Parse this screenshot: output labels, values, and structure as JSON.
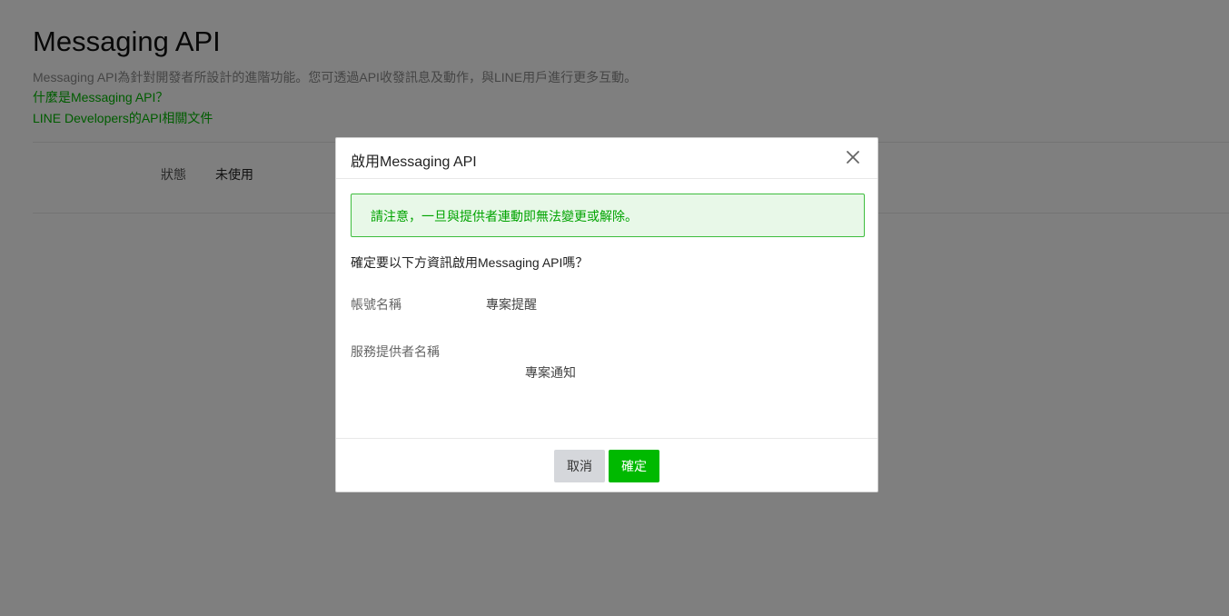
{
  "page": {
    "title": "Messaging API",
    "description": "Messaging API為針對開發者所設計的進階功能。您可透過API收發訊息及動作，與LINE用戶進行更多互動。",
    "links": [
      "什麼是Messaging API？",
      "LINE Developers的API相關文件"
    ],
    "status_label": "狀態",
    "status_value": "未使用"
  },
  "modal": {
    "title": "啟用Messaging API",
    "close_icon": "close-icon",
    "alert": "請注意，一旦與提供者連動即無法變更或解除。",
    "question": "確定要以下方資訊啟用Messaging API嗎？",
    "fields": [
      {
        "label": "帳號名稱",
        "value": "專案提醒"
      },
      {
        "label": "服務提供者名稱",
        "value": "專案通知"
      }
    ],
    "cancel_label": "取消",
    "confirm_label": "確定"
  },
  "colors": {
    "accent": "#00b900",
    "overlay": "rgba(0,0,0,0.5)",
    "alert_bg": "#e8f8e8"
  }
}
